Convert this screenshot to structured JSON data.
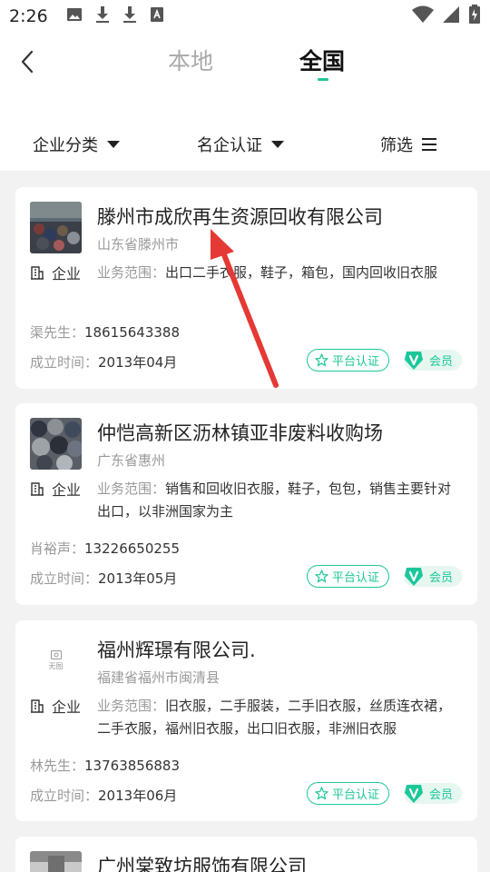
{
  "status": {
    "time": "2:26"
  },
  "tabs": {
    "local": "本地",
    "national": "全国"
  },
  "filters": {
    "category": "企业分类",
    "certification": "名企认证",
    "filter": "筛选"
  },
  "cards": [
    {
      "name": "滕州市成欣再生资源回收有限公司",
      "location": "山东省滕州市",
      "type": "企业",
      "scope_label": "业务范围：",
      "scope": "出口二手衣服，鞋子，箱包，国内回收旧衣服",
      "contact_label": "渠先生：",
      "phone": "18615643388",
      "founded_label": "成立时间：",
      "founded": "2013年04月",
      "cert": "平台认证",
      "vip": "会员"
    },
    {
      "name": "仲恺高新区沥林镇亚非废料收购场",
      "location": "广东省惠州",
      "type": "企业",
      "scope_label": "业务范围：",
      "scope": "销售和回收旧衣服，鞋子，包包，销售主要针对出口，以非洲国家为主",
      "contact_label": "肖裕声：",
      "phone": "13226650255",
      "founded_label": "成立时间：",
      "founded": "2013年05月",
      "cert": "平台认证",
      "vip": "会员"
    },
    {
      "name": "福州辉璟有限公司.",
      "location": "福建省福州市闽清县",
      "noimg": "无图",
      "type": "企业",
      "scope_label": "业务范围：",
      "scope": "旧衣服，二手服装，二手旧衣服，丝质连衣裙，二手衣服，福州旧衣服，出口旧衣服，非洲旧衣服",
      "contact_label": "林先生：",
      "phone": "13763856883",
      "founded_label": "成立时间：",
      "founded": "2013年06月",
      "cert": "平台认证",
      "vip": "会员"
    },
    {
      "name": "广州棠致坊服饰有限公司"
    }
  ]
}
